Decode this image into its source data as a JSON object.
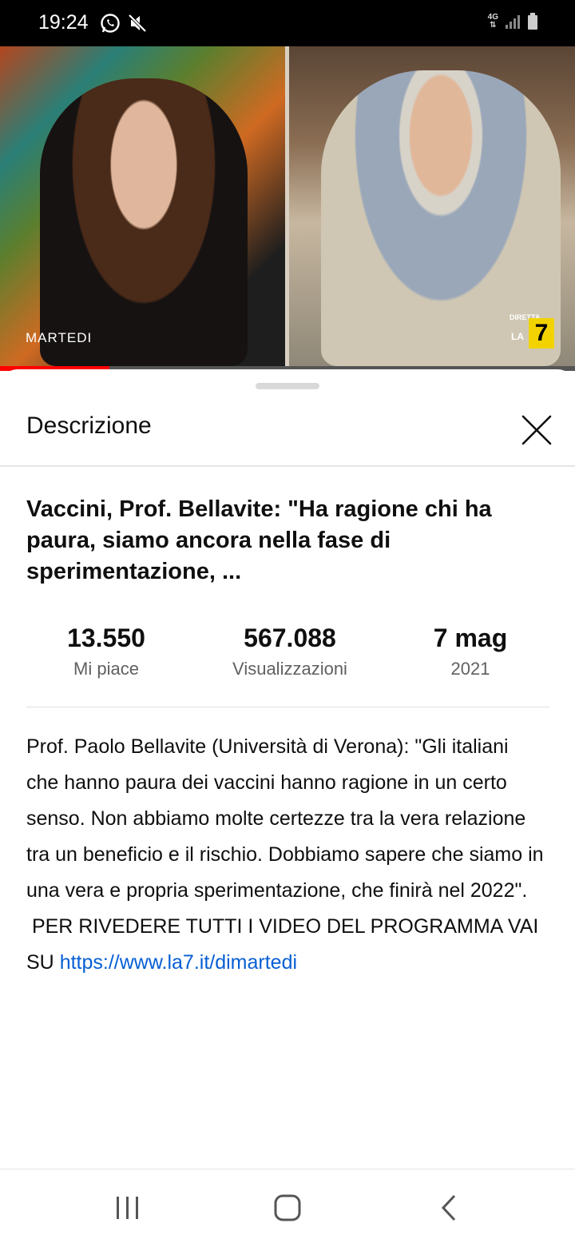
{
  "status_bar": {
    "time": "19:24",
    "network": "4G",
    "icons": [
      "whatsapp-icon",
      "mute-icon",
      "signal-icon",
      "battery-icon"
    ]
  },
  "video": {
    "left_overlay": "MARTEDI",
    "right_overlay_top": "DIRETTA",
    "right_overlay_la": "LA",
    "right_overlay_seven": "7",
    "progress": 0.19,
    "progress_color": "#ff0000"
  },
  "sheet": {
    "title": "Descrizione",
    "close_icon": "close-icon"
  },
  "video_info": {
    "title": "Vaccini, Prof. Bellavite: \"Ha ragione chi ha paura, siamo ancora nella fase di sperimentazione, ...",
    "stats": [
      {
        "value": "13.550",
        "label": "Mi piace"
      },
      {
        "value": "567.088",
        "label": "Visualizzazioni"
      },
      {
        "value": "7 mag",
        "label": "2021"
      }
    ],
    "description": "Prof. Paolo Bellavite (Università di Verona): \"Gli italiani che hanno paura dei vaccini hanno ragione in un certo senso. Non abbiamo molte certezze tra la vera relazione tra un beneficio e il rischio. Dobbiamo sapere che siamo in una vera e propria sperimentazione, che finirà nel 2022\".\n PER RIVEDERE TUTTI I VIDEO DEL PROGRAMMA VAI SU ",
    "link": "https://www.la7.it/dimartedi",
    "link_color": "#065fd4"
  },
  "nav_bar": {
    "buttons": [
      "recent-apps-icon",
      "home-icon",
      "back-icon"
    ]
  }
}
